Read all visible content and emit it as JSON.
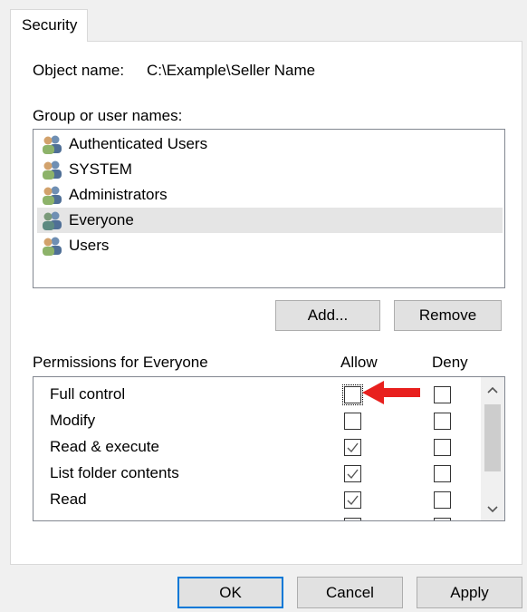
{
  "tab": {
    "label": "Security"
  },
  "object": {
    "label": "Object name:",
    "value": "C:\\Example\\Seller Name"
  },
  "group_list": {
    "label": "Group or user names:",
    "items": [
      {
        "label": "Authenticated Users",
        "selected": false
      },
      {
        "label": "SYSTEM",
        "selected": false
      },
      {
        "label": "Administrators",
        "selected": false
      },
      {
        "label": "Everyone",
        "selected": true
      },
      {
        "label": "Users",
        "selected": false
      }
    ]
  },
  "buttons": {
    "add": "Add...",
    "remove": "Remove",
    "ok": "OK",
    "cancel": "Cancel",
    "apply": "Apply"
  },
  "permissions": {
    "label": "Permissions for Everyone",
    "allow_header": "Allow",
    "deny_header": "Deny",
    "rows": [
      {
        "label": "Full control",
        "allow": false,
        "deny": false
      },
      {
        "label": "Modify",
        "allow": false,
        "deny": false
      },
      {
        "label": "Read & execute",
        "allow": true,
        "deny": false
      },
      {
        "label": "List folder contents",
        "allow": true,
        "deny": false
      },
      {
        "label": "Read",
        "allow": true,
        "deny": false
      }
    ]
  },
  "colors": {
    "accent": "#0078d7",
    "annotation_arrow": "#e8201e",
    "selection": "#e5e5e5"
  }
}
